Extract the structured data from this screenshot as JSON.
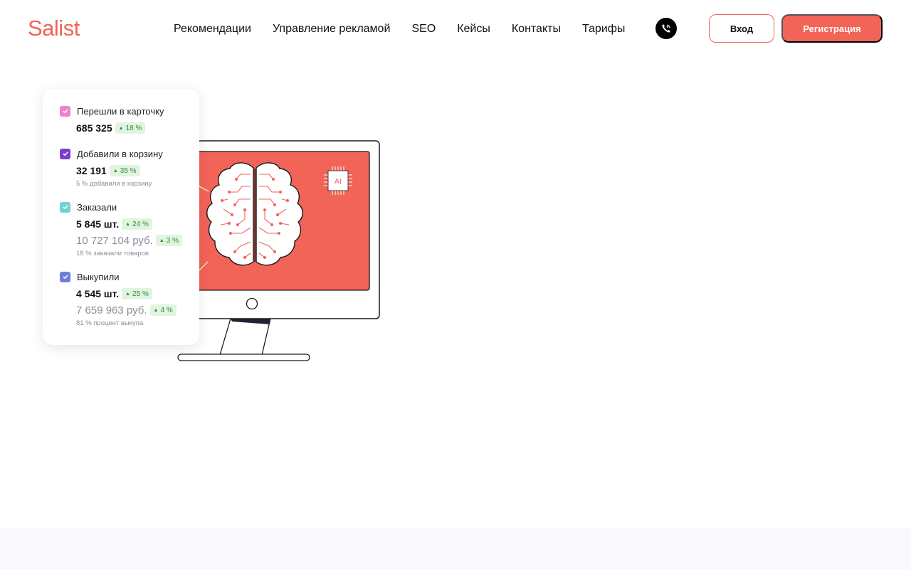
{
  "header": {
    "logo": "Salist",
    "nav": [
      "Рекомендации",
      "Управление рекламой",
      "SEO",
      "Кейсы",
      "Контакты",
      "Тарифы"
    ],
    "login_label": "Вход",
    "register_label": "Регистрация",
    "phone_icon": "phone-icon"
  },
  "illustration": {
    "chip_label": "AI",
    "icons": [
      "monitor-illustration",
      "brain-icon",
      "ai-chip-icon"
    ],
    "colors": {
      "screen": "#f26457",
      "outline": "#1a1a1a"
    }
  },
  "stats": [
    {
      "label": "Перешли в карточку",
      "value": "685 325",
      "badge": "18 %",
      "color": "#f27fd1"
    },
    {
      "label": "Добавили в корзину",
      "value": "32 191",
      "badge": "35 %",
      "note": "5 % добавили в корзину",
      "color": "#7a3fc9"
    },
    {
      "label": "Заказали",
      "value": "5 845 шт.",
      "badge": "24 %",
      "secondary_value": "10 727 104 руб.",
      "secondary_badge": "3 %",
      "note": "18 % заказали товаров",
      "color": "#6fd3d6"
    },
    {
      "label": "Выкупили",
      "value": "4 545 шт.",
      "badge": "25 %",
      "secondary_value": "7 659 963 руб.",
      "secondary_badge": "4 %",
      "note": "81 % процент выкупа",
      "color": "#6f7fd9"
    }
  ],
  "colors": {
    "accent": "#f26457",
    "badge_bg": "#e2f3e0",
    "badge_text": "#2e8a3c",
    "muted_text": "#8b8e99"
  }
}
